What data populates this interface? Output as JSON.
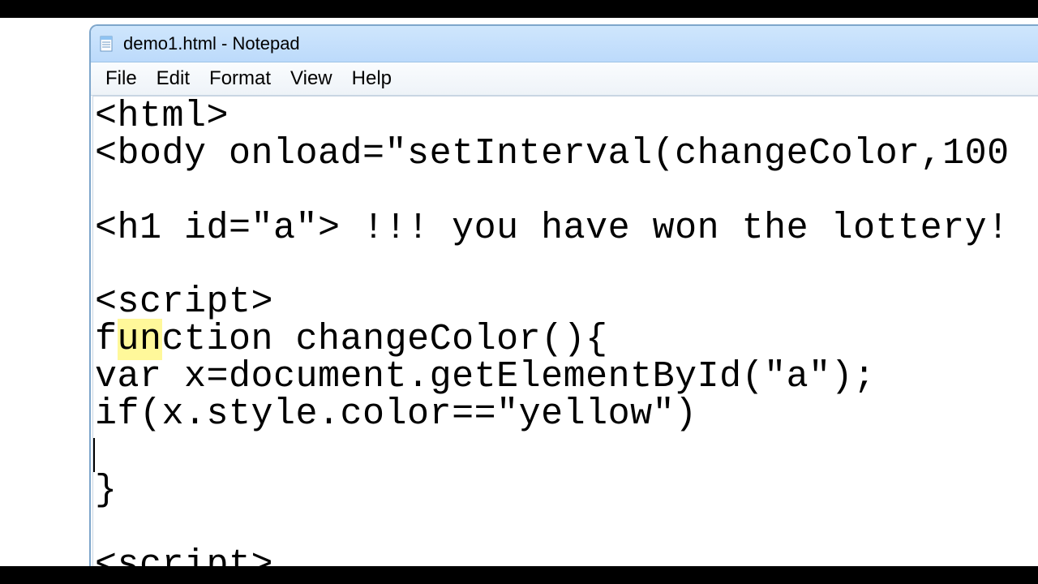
{
  "window": {
    "title": "demo1.html - Notepad"
  },
  "menubar": {
    "file": "File",
    "edit": "Edit",
    "format": "Format",
    "view": "View",
    "help": "Help"
  },
  "code": {
    "l1": "<html>",
    "l2": "<body onload=\"setInterval(changeColor,100",
    "l3": "",
    "l4": "<h1 id=\"a\"> !!! you have won the lottery!",
    "l5": "",
    "l6": "<script>",
    "l7a": "f",
    "l7b_hl": "un",
    "l7c": "ction changeColor(){",
    "l8": "var x=document.getElementById(\"a\");",
    "l9": "if(x.style.color==\"yellow\")",
    "l10": "",
    "l11": "}",
    "l12": "",
    "l13": "<script>"
  }
}
